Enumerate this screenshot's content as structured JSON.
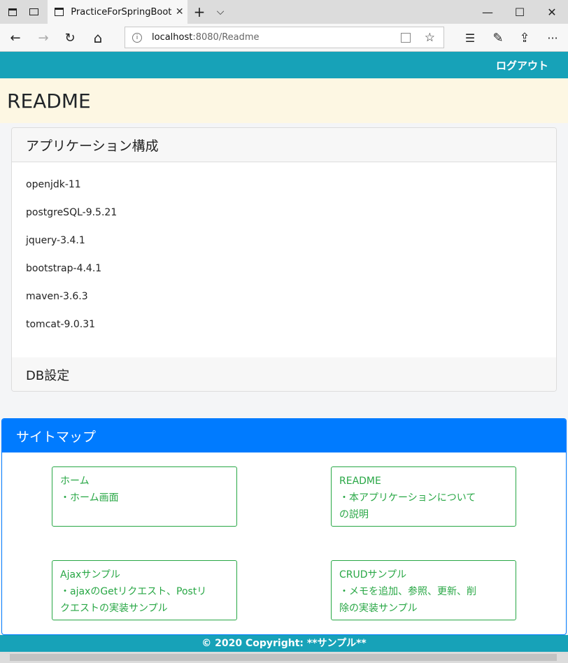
{
  "browser": {
    "tab_title": "PracticeForSpringBoot",
    "url_host": "localhost",
    "url_rest": ":8080/Readme",
    "new_tab": "+",
    "tab_list": "⌵",
    "minimize": "—",
    "maximize": "☐",
    "close": "✕",
    "back": "←",
    "forward": "→",
    "refresh": "↻",
    "home": "⌂",
    "favorite": "☆",
    "favorites_list": "☰",
    "pen": "✎",
    "share": "⇪",
    "more": "···",
    "tab_close": "✕"
  },
  "header": {
    "logout_label": "ログアウト"
  },
  "jumbotron": {
    "title": "README"
  },
  "app_card": {
    "title": "アプリケーション構成",
    "items": [
      "openjdk-11",
      "postgreSQL-9.5.21",
      "jquery-3.4.1",
      "bootstrap-4.4.1",
      "maven-3.6.3",
      "tomcat-9.0.31"
    ],
    "db_title": "DB設定"
  },
  "sitemap": {
    "title": "サイトマップ",
    "boxes": [
      {
        "line1": "ホーム",
        "line2": "・ホーム画面",
        "line3": ""
      },
      {
        "line1": "README",
        "line2": "・本アプリケーションについて",
        "line3": "の説明"
      },
      {
        "line1": "Ajaxサンプル",
        "line2": "・ajaxのGetリクエスト、Postリ",
        "line3": "クエストの実装サンプル"
      },
      {
        "line1": "CRUDサンプル",
        "line2": "・メモを追加、参照、更新、削",
        "line3": "除の実装サンプル"
      }
    ]
  },
  "footer": {
    "text": "© 2020 Copyright: **サンプル**"
  },
  "colors": {
    "teal": "#17a2b8",
    "primary": "#007bff",
    "success": "#28a745",
    "jumbotron_bg": "#fdf7e3"
  }
}
